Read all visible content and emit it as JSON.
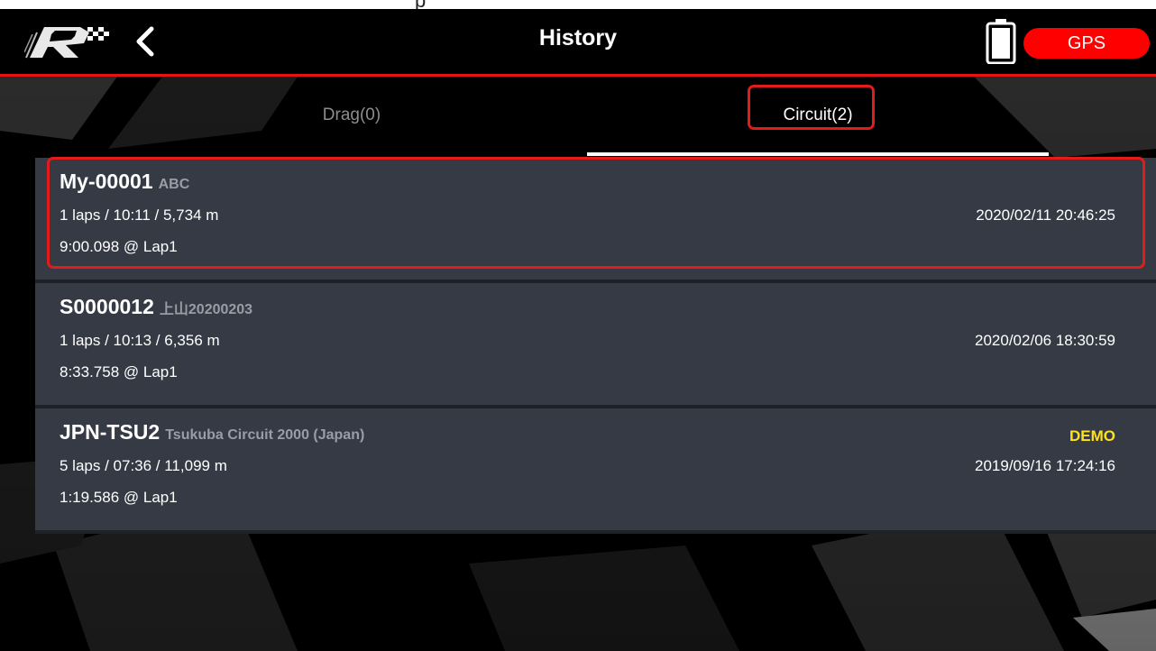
{
  "top_fragment": "p",
  "header": {
    "title": "History",
    "gps_label": "GPS"
  },
  "tabs": [
    {
      "label": "Drag(0)",
      "active": false
    },
    {
      "label": "Circuit(2)",
      "active": true
    }
  ],
  "sessions": [
    {
      "code": "My-00001",
      "name": "ABC",
      "summary": "1 laps / 10:11 / 5,734 m",
      "best": "9:00.098 @ Lap1",
      "datetime": "2020/02/11 20:46:25",
      "badge": ""
    },
    {
      "code": "S0000012",
      "name": "上山20200203",
      "summary": "1 laps / 10:13 / 6,356 m",
      "best": "8:33.758 @ Lap1",
      "datetime": "2020/02/06 18:30:59",
      "badge": ""
    },
    {
      "code": "JPN-TSU2",
      "name": "Tsukuba Circuit 2000 (Japan)",
      "summary": "5 laps / 07:36 / 11,099 m",
      "best": "1:19.586 @ Lap1",
      "datetime": "2019/09/16 17:24:16",
      "badge": "DEMO"
    }
  ],
  "colors": {
    "accent": "#e01515",
    "gps": "#ff0000",
    "row_bg": "#363a45",
    "demo": "#ffe21a",
    "muted_text": "#9a9da5"
  },
  "icons": [
    "logo-icon",
    "back-chevron-icon",
    "battery-icon"
  ]
}
